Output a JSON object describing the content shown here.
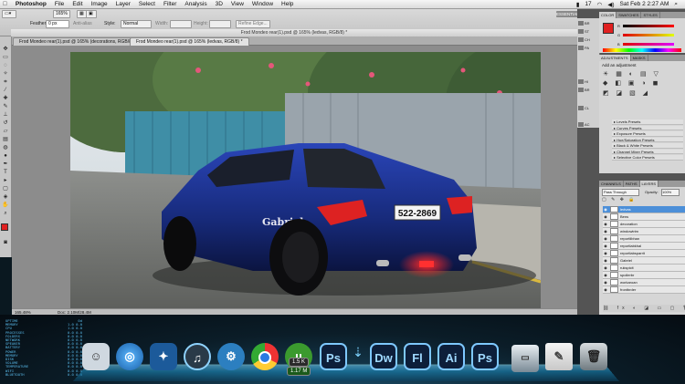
{
  "menubar": {
    "app": "Photoshop",
    "items": [
      "File",
      "Edit",
      "Image",
      "Layer",
      "Select",
      "Filter",
      "Analysis",
      "3D",
      "View",
      "Window",
      "Help"
    ],
    "status": {
      "battery_count": "17",
      "clock": "Sat Feb 2  2:27 AM"
    }
  },
  "options": {
    "zoom": "165%",
    "feather_label": "Feather:",
    "feather_value": "0 px",
    "anti_alias": "Anti-alias",
    "style_label": "Style:",
    "style_value": "Normal",
    "width_label": "Width:",
    "height_label": "Height:",
    "refine_edge": "Refine Edge..."
  },
  "essentials": "ESSENTIALS",
  "document": {
    "title": "Frod Mondeo rear(1).psd @ 165% (ledvas, RGB/8) *",
    "tabs": [
      "Frod Mondeo rear(1).psd @ 165% (decorations, RGB/8) *",
      "Frod Mondeo rear(1).psd @ 165% (ledvas, RGB/8) *"
    ],
    "status_zoom": "165.48%",
    "status_doc": "Doc: 2.10M/28.4M",
    "car_name": "Gabriel",
    "plate": "522-2869"
  },
  "panels": {
    "color_tabs": [
      "COLOR",
      "SWATCHES",
      "STYLES"
    ],
    "color_values": {
      "r": "R",
      "g": "G",
      "b": "B"
    },
    "adjust_tabs": [
      "ADJUSTMENTS",
      "MASKS"
    ],
    "add_adjustment": "Add an adjustment",
    "presets": [
      "Levels Presets",
      "Curves Presets",
      "Exposure Presets",
      "Hue/Saturation Presets",
      "Black & White Presets",
      "Channel Mixer Presets",
      "Selective Color Presets"
    ],
    "layer_tabs": [
      "CHANNELS",
      "PATHS",
      "LAYERS"
    ],
    "blend_mode": "Pass Through",
    "opacity_label": "Opacity:",
    "opacity_value": "100%",
    "layers": [
      "ledvas",
      "Bens",
      "decoration",
      "windowtrim",
      "reportlibhan",
      "reportlabkhal",
      "reportlabsparrit",
      "Gabriel",
      "rukspicit",
      "spoilerbr",
      "workaroan",
      "frontbrder"
    ],
    "strip": [
      "BR",
      "ST",
      "CH",
      "PA",
      "HI",
      "BR",
      "CL",
      "AC"
    ]
  },
  "dock": {
    "icons": [
      "Finder",
      "Safari",
      "Nav",
      "iTunes",
      "System Preferences",
      "Chrome",
      "uTorrent",
      "Ps",
      "Dw",
      "Fl",
      "Ai",
      "Ps",
      "Drive",
      "Preview",
      "Trash"
    ],
    "badge_up": "1.5 K",
    "badge_down": "1.17 M"
  },
  "stats": [
    [
      "UPTIME",
      "0d"
    ],
    [
      "MEMORY",
      "1.0 0.0"
    ],
    [
      "CPU",
      "1.0 0.0"
    ],
    [
      "PROCESSES",
      "0.0 0.0"
    ],
    [
      "FOLDERS",
      "0.0 0.0"
    ],
    [
      "NETWORK",
      "0.0 0.0"
    ],
    [
      "SPEAKER",
      "0.0 0.0"
    ],
    [
      "BATTERY",
      "0.0 0.0"
    ],
    [
      "POWER",
      "0.0 0.0"
    ],
    [
      "MEMORY",
      "0.0 0.0"
    ],
    [
      "DISK",
      "0.0 0.0"
    ],
    [
      "VOLUME",
      "0.0 0.0"
    ],
    [
      "TEMPERATURE",
      "0.0 0.0"
    ],
    [
      "WIFI",
      "0.0 0.0"
    ],
    [
      "BLUETOOTH",
      "0.0 0.0"
    ]
  ],
  "colors": {
    "foreground": "#e02020",
    "background": "#ffffff",
    "layer_selected": "#4c8fd8",
    "car_body": "#1a2f8a"
  }
}
